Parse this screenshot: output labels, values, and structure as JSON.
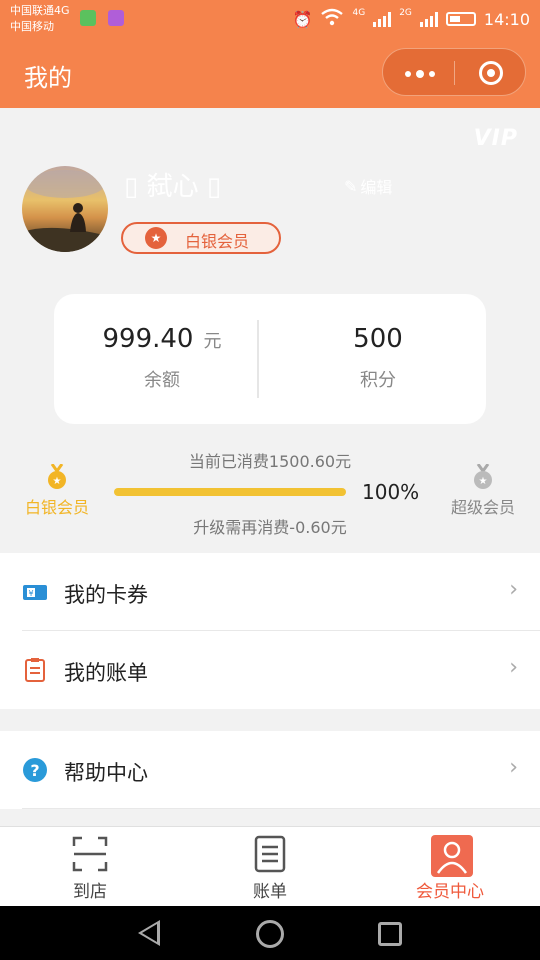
{
  "status_bar": {
    "carrier_line1": "中国联通4G",
    "carrier_line2": "中国移动",
    "net1": "4G",
    "net2": "2G",
    "time": "14:10"
  },
  "header": {
    "title": "我的"
  },
  "profile": {
    "vip_mark": "VIP",
    "nickname": "▯ 弑心 ▯",
    "edit_label": "编辑",
    "member_level": "白银会员"
  },
  "stats": {
    "balance_value": "999.40",
    "balance_unit": "元",
    "balance_label": "余额",
    "points_value": "500",
    "points_label": "积分"
  },
  "membership": {
    "spent_text": "当前已消费1500.60元",
    "current_level": "白银会员",
    "next_level": "超级会员",
    "progress_percent": 100,
    "progress_text": "100%",
    "upgrade_text": "升级需再消费-0.60元",
    "colors": {
      "current": "#f2b526",
      "next": "#aaaaaa",
      "bar": "#f2c233"
    }
  },
  "menu": {
    "group1": [
      {
        "label": "我的卡券",
        "icon": "coupon-icon"
      },
      {
        "label": "我的账单",
        "icon": "bill-icon"
      }
    ],
    "group2": [
      {
        "label": "帮助中心",
        "icon": "help-icon"
      }
    ]
  },
  "tabbar": {
    "items": [
      {
        "label": "到店",
        "icon": "scan-icon"
      },
      {
        "label": "账单",
        "icon": "bill-list-icon"
      },
      {
        "label": "会员中心",
        "icon": "member-icon",
        "active": true
      }
    ],
    "active_color": "#ef5a3c"
  },
  "theme": {
    "accent": "#f5834c",
    "badge": "#e4623c"
  }
}
